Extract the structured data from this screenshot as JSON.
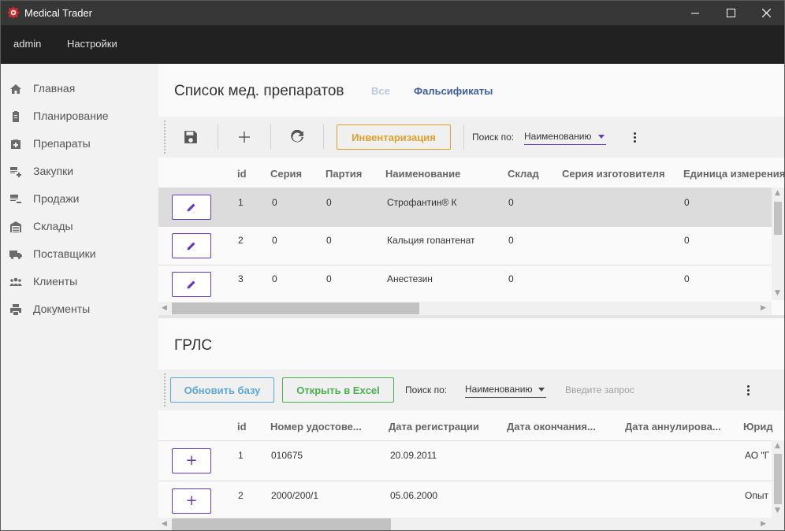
{
  "window": {
    "title": "Medical Trader",
    "controls": {
      "minimize": "minimize-icon",
      "maximize": "maximize-icon",
      "close": "close-icon"
    }
  },
  "menu": {
    "items": [
      "admin",
      "Настройки"
    ]
  },
  "sidebar": {
    "items": [
      {
        "label": "Главная",
        "icon": "home-icon"
      },
      {
        "label": "Планирование",
        "icon": "clipboard-icon"
      },
      {
        "label": "Препараты",
        "icon": "medical-bag-icon"
      },
      {
        "label": "Закупки",
        "icon": "cart-add-icon"
      },
      {
        "label": "Продажи",
        "icon": "sale-icon"
      },
      {
        "label": "Склады",
        "icon": "warehouse-icon"
      },
      {
        "label": "Поставщики",
        "icon": "truck-icon"
      },
      {
        "label": "Клиенты",
        "icon": "people-icon"
      },
      {
        "label": "Документы",
        "icon": "printer-icon"
      }
    ]
  },
  "drugs": {
    "title": "Список мед. препаратов",
    "filters": {
      "all": "Все",
      "falsified": "Фальсификаты"
    },
    "toolbar": {
      "save_icon": "save-icon",
      "add_icon": "plus-icon",
      "refresh_icon": "refresh-icon",
      "inventory_label": "Инвентаризация",
      "search_label": "Поиск по:",
      "search_field": "Наименованию",
      "menu_icon": "more-vert-icon"
    },
    "columns": [
      "id",
      "Серия",
      "Партия",
      "Наименование",
      "Склад",
      "Серия изготовителя",
      "Единица измерения"
    ],
    "rows": [
      {
        "id": "1",
        "series": "0",
        "batch": "0",
        "name": "Строфантин® К",
        "warehouse": "0",
        "maker_series": "",
        "unit": "0"
      },
      {
        "id": "2",
        "series": "0",
        "batch": "0",
        "name": "Кальция гопантенат",
        "warehouse": "0",
        "maker_series": "",
        "unit": "0"
      },
      {
        "id": "3",
        "series": "0",
        "batch": "0",
        "name": "Анестезин",
        "warehouse": "0",
        "maker_series": "",
        "unit": "0"
      }
    ],
    "selected_row": 1
  },
  "grls": {
    "title": "ГРЛС",
    "toolbar": {
      "update_label": "Обновить базу",
      "excel_label": "Открыть в Excel",
      "search_label": "Поиск по:",
      "search_field": "Наименованию",
      "query_placeholder": "Введите запрос",
      "menu_icon": "more-vert-icon"
    },
    "columns": [
      "id",
      "Номер удостове...",
      "Дата регистрации",
      "Дата окончания...",
      "Дата аннулирова...",
      "Юрид"
    ],
    "rows": [
      {
        "id": "1",
        "number": "010675",
        "reg_date": "20.09.2011",
        "end_date": "",
        "cancel_date": "",
        "legal": "АО \"Г"
      },
      {
        "id": "2",
        "number": "2000/200/1",
        "reg_date": "05.06.2000",
        "end_date": "",
        "cancel_date": "",
        "legal": "Опыт"
      }
    ]
  },
  "colors": {
    "accent": "#673ab7",
    "inventory": "#e0a030",
    "update": "#5aa7d6",
    "excel": "#4caf50",
    "filter_all": "#b8c8de",
    "filter_falsified": "#3f5f9f"
  }
}
